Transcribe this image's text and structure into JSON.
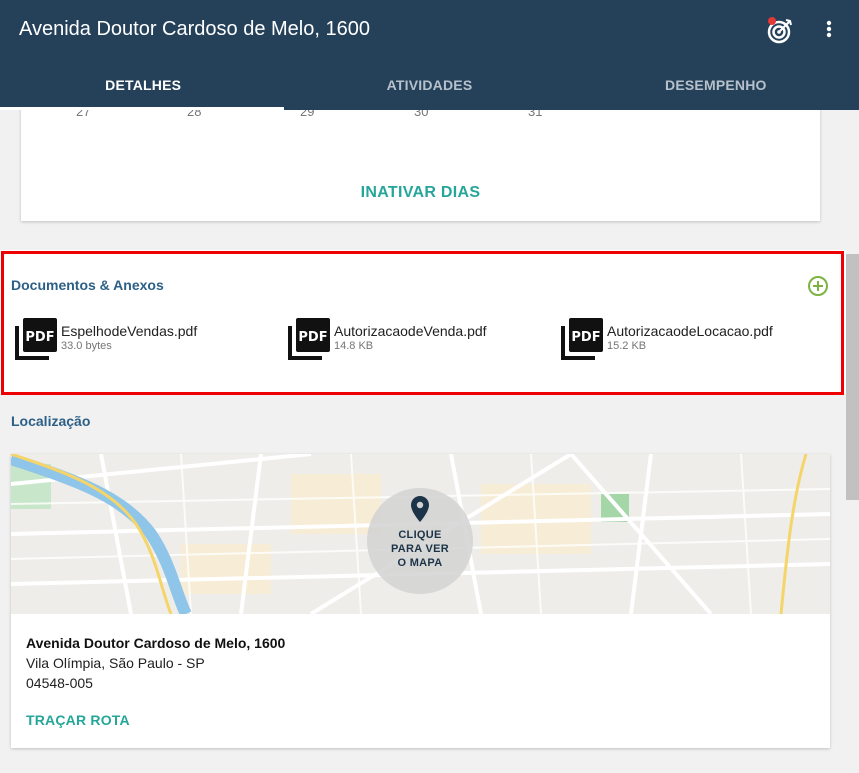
{
  "appbar": {
    "title": "Avenida Doutor Cardoso de Melo, 1600",
    "target_icon": "target-icon",
    "more_icon": "more-vert-icon",
    "background": "#25415a"
  },
  "tabs": [
    {
      "label": "DETALHES",
      "active": true
    },
    {
      "label": "ATIVIDADES",
      "active": false
    },
    {
      "label": "DESEMPENHO",
      "active": false
    }
  ],
  "calendar": {
    "visible_days": [
      "27",
      "28",
      "29",
      "30",
      "31"
    ],
    "inactivate_label": "INATIVAR DIAS"
  },
  "documents": {
    "title": "Documentos & Anexos",
    "add_icon": "add-circle-icon",
    "files": [
      {
        "name": "EspelhodeVendas.pdf",
        "size": "33.0 bytes",
        "icon": "pdf-icon"
      },
      {
        "name": "AutorizacaodeVenda.pdf",
        "size": "14.8 KB",
        "icon": "pdf-icon"
      },
      {
        "name": "AutorizacaodeLocacao.pdf",
        "size": "15.2 KB",
        "icon": "pdf-icon"
      }
    ]
  },
  "location": {
    "title": "Localização",
    "map_cta": "CLIQUE\nPARA VER\nO MAPA",
    "address_title": "Avenida Doutor Cardoso de Melo, 1600",
    "address_lines": [
      "Vila Olímpia, São Paulo - SP",
      "04548-005"
    ],
    "route_label": "TRAÇAR ROTA"
  },
  "colors": {
    "accent": "#26a69a",
    "section_title": "#2c5f86",
    "highlight": "#ee0000"
  }
}
